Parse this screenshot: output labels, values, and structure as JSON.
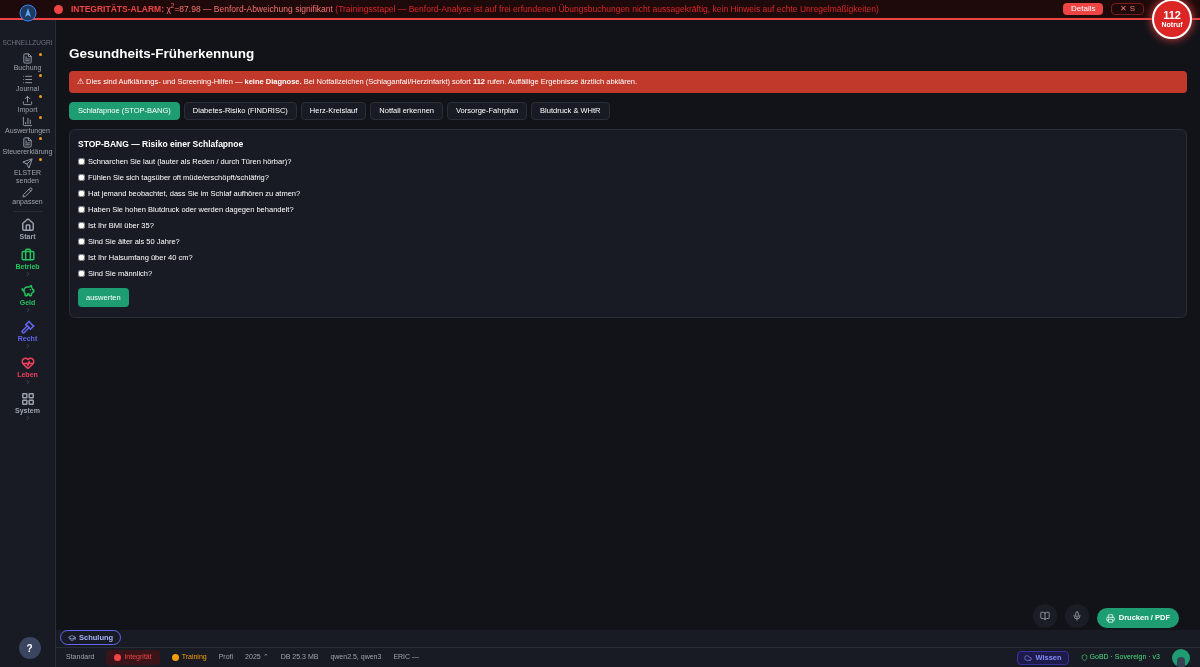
{
  "alarm": {
    "title": "INTEGRITÄTS-ALARM:",
    "formula": "χ$^{2}$=87.98 — Benford-Abweichung signifikant",
    "detail": "(Trainingsstapel — Benford-Analyse ist auf frei erfundenen Übungsbuchungen nicht aussagekräftig, kein Hinweis auf echte Unregelmäßigkeiten)",
    "details_button": "Details",
    "close_button": "✕ S"
  },
  "emergency": {
    "number": "112",
    "label": "Notruf"
  },
  "sidebar": {
    "quick_label": "SCHNELLZUGRI",
    "quick_items": [
      {
        "label": "Buchung",
        "starred": true
      },
      {
        "label": "Journal",
        "starred": true
      },
      {
        "label": "Import",
        "starred": true
      },
      {
        "label": "Auswertungen",
        "starred": true
      },
      {
        "label": "Steuererklärung",
        "starred": true
      },
      {
        "label": "ELSTER senden",
        "starred": true
      },
      {
        "label": "anpassen",
        "starred": false
      }
    ],
    "sections": [
      {
        "label": "Start",
        "color": "#9ca3af",
        "expandable": false
      },
      {
        "label": "Betrieb",
        "color": "#22c55e",
        "expandable": true
      },
      {
        "label": "Geld",
        "color": "#22c55e",
        "expandable": true
      },
      {
        "label": "Recht",
        "color": "#6366f1",
        "expandable": true
      },
      {
        "label": "Leben",
        "color": "#f43f5e",
        "expandable": true
      },
      {
        "label": "System",
        "color": "#9ca3af",
        "expandable": true
      }
    ]
  },
  "page": {
    "title": "Gesundheits-Früherkennung",
    "warning": "⚠ Dies sind Aufklärungs- und Screening-Hilfen — **keine Diagnose.** Bei Notfallzeichen (Schlaganfall/Herzinfarkt) sofort **112** rufen. Auffällige Ergebnisse ärztlich abklären.",
    "tabs": [
      {
        "label": "Schlafapnoe (STOP-BANG)",
        "selected": true
      },
      {
        "label": "Diabetes-Risiko (FINDRISC)",
        "selected": false
      },
      {
        "label": "Herz-Kreislauf",
        "selected": false
      },
      {
        "label": "Notfall erkennen",
        "selected": false
      },
      {
        "label": "Vorsorge-Fahrplan",
        "selected": false
      },
      {
        "label": "Blutdruck & WHtR",
        "selected": false
      }
    ],
    "card": {
      "title": "STOP-BANG — Risiko einer Schlafapnoe",
      "questions": [
        {
          "label": "Schnarchen Sie laut (lauter als Reden / durch Türen hörbar)?",
          "checked": false
        },
        {
          "label": "Fühlen Sie sich tagsüber oft müde/erschöpft/schläfrig?",
          "checked": false
        },
        {
          "label": "Hat jemand beobachtet, dass Sie im Schlaf aufhören zu atmen?",
          "checked": false
        },
        {
          "label": "Haben Sie hohen Blutdruck oder werden dagegen behandelt?",
          "checked": false
        },
        {
          "label": "Ist Ihr BMI über 35?",
          "checked": false
        },
        {
          "label": "Sind Sie älter als 50 Jahre?",
          "checked": false
        },
        {
          "label": "Ist Ihr Halsumfang über 40 cm?",
          "checked": false
        },
        {
          "label": "Sind Sie männlich?",
          "checked": false
        }
      ],
      "button": "auswerten"
    }
  },
  "help_button": "?",
  "training_button": "Schulung",
  "status_bar": [
    {
      "label": "Standard",
      "kind": "plain"
    },
    {
      "label": "Integrität",
      "kind": "alert"
    },
    {
      "label": "Training",
      "kind": "training"
    },
    {
      "label": "Profi",
      "kind": "plain"
    },
    {
      "label": "2025 ⌃",
      "kind": "plain"
    },
    {
      "label": "DB 25.3 MB",
      "kind": "plain"
    },
    {
      "label": "qwen2.5, qwen3",
      "kind": "plain"
    },
    {
      "label": "ERIC —",
      "kind": "plain"
    }
  ],
  "print_button": "Drucken / PDF",
  "knowledge_button": "Wissen",
  "version": "GoBD · Sovereign · v3"
}
